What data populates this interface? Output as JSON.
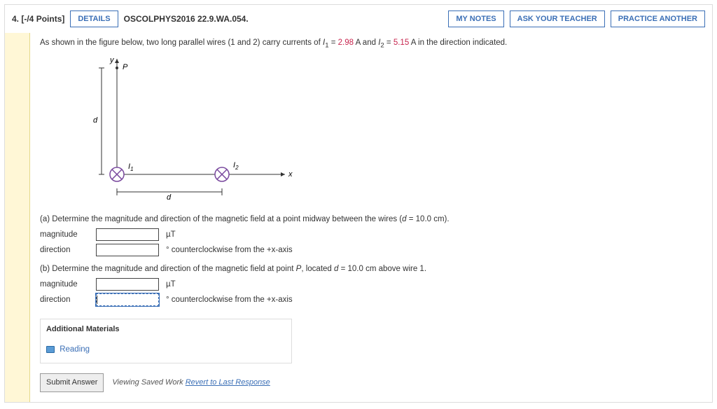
{
  "header": {
    "qnum": "4.",
    "points": "[-/4 Points]",
    "details": "DETAILS",
    "ref": "OSCOLPHYS2016 22.9.WA.054.",
    "mynotes": "MY NOTES",
    "ask": "ASK YOUR TEACHER",
    "practice": "PRACTICE ANOTHER"
  },
  "intro": {
    "pre": "As shown in the figure below, two long parallel wires (1 and 2) carry currents of ",
    "i1sym": "I",
    "i1sub": "1",
    "eq": " = ",
    "i1val": "2.98",
    "mid": " A and ",
    "i2sym": "I",
    "i2sub": "2",
    "i2val": "5.15",
    "post": " A in the direction indicated."
  },
  "fig": {
    "y": "y",
    "x": "x",
    "P": "P",
    "d": "d",
    "I1": "I",
    "I1sub": "1",
    "I2": "I",
    "I2sub": "2"
  },
  "partA": {
    "q": "(a) Determine the magnitude and direction of the magnetic field at a point midway between the wires (",
    "dsym": "d",
    "eq": " = 10.0 cm).",
    "mag": "magnitude",
    "unit": "µT",
    "dir": "direction",
    "note": "° counterclockwise from the +x-axis"
  },
  "partB": {
    "q": "(b) Determine the magnitude and direction of the magnetic field at point ",
    "Psym": "P",
    "mid": ", located ",
    "dsym": "d",
    "eq": " = 10.0 cm above wire 1.",
    "mag": "magnitude",
    "unit": "µT",
    "dir": "direction",
    "note": "° counterclockwise from the +x-axis"
  },
  "addmat": {
    "title": "Additional Materials",
    "reading": "Reading"
  },
  "footer": {
    "submit": "Submit Answer",
    "saved": "Viewing Saved Work ",
    "revert": "Revert to Last Response"
  }
}
